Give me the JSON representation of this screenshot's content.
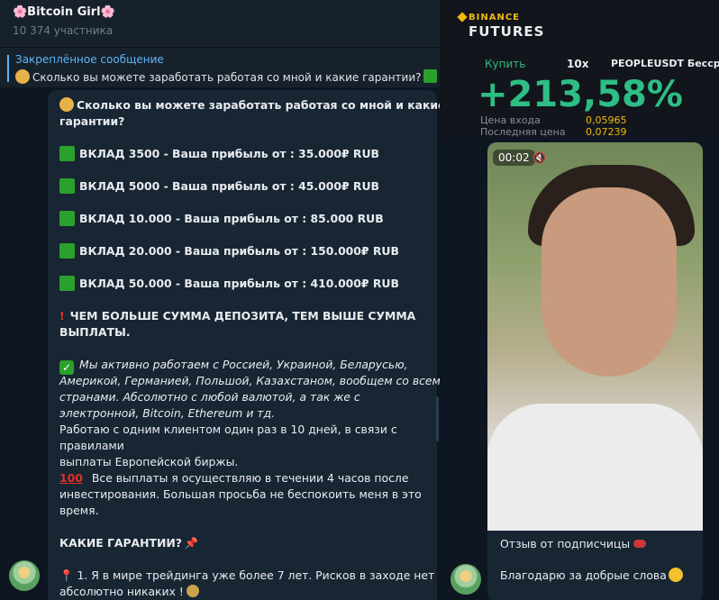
{
  "channel": {
    "title": "🌸Bitcoin Girl🌸",
    "members": "10 374 участника"
  },
  "pinned": {
    "label": "Закреплённое сообщение",
    "text": "Сколько вы можете заработать работая со мной и какие гарантии?"
  },
  "message": {
    "title_line1": "Сколько вы можете заработать работая со мной и какие",
    "title_line2": "гарантии?",
    "deposits": [
      "ВКЛАД 3500 - Ваша прибыль от : 35.000₽ RUB",
      "ВКЛАД 5000 - Ваша прибыль от : 45.000₽ RUB",
      "ВКЛАД 10.000 - Ваша прибыль от : 85.000 RUB",
      "ВКЛАД 20.000 - Ваша прибыль от : 150.000₽ RUB",
      "ВКЛАД 50.000 - Ваша прибыль от : 410.000₽ RUB"
    ],
    "warning_line1": "ЧЕМ БОЛЬШЕ СУММА ДЕПОЗИТА, ТЕМ ВЫШЕ СУММА",
    "warning_line2": "ВЫПЛАТЫ.",
    "italic_line1": "Мы активно работаем с Россией, Украиной, Беларусью,",
    "italic_line2": "Америкой, Германией, Польшой, Казахстаном, вообщем со всеми",
    "italic_line3": "странами. Абсолютно с любой валютой, а так же с",
    "italic_line4": "электронной, Bitcoin, Ethereum и тд.",
    "plain_line1": "Работаю с одним клиентом один раз в 10 дней, в связи с",
    "plain_line2": "правилами",
    "plain_line3": "выплаты Европейской биржы.",
    "payout_line1": "Все выплаты я осуществляю в течении 4 часов после",
    "payout_line2": "инвестирования. Большая просьба не беспокоить меня в это",
    "payout_line3": "время.",
    "guarantees_header": "КАКИЕ ГАРАНТИИ?",
    "guarantee1_line1": "1. Я в мире трейдинга уже более 7 лет.  Рисков в заходе нет",
    "guarantee1_line2": "абсолютно никаких !"
  },
  "binance": {
    "logo": "BINANCE",
    "product": "FUTURES",
    "side": "Купить",
    "leverage": "10x",
    "pair": "PEOPLEUSDT Бессро",
    "pnl": "+213,58%",
    "entry_label": "Цена входа",
    "entry_value": "0,05965",
    "last_label": "Последняя цена",
    "last_value": "0,07239"
  },
  "video": {
    "time": "00:02",
    "caption1": "Отзыв от подписчицы",
    "caption2": "Благодарю за добрые слова"
  }
}
